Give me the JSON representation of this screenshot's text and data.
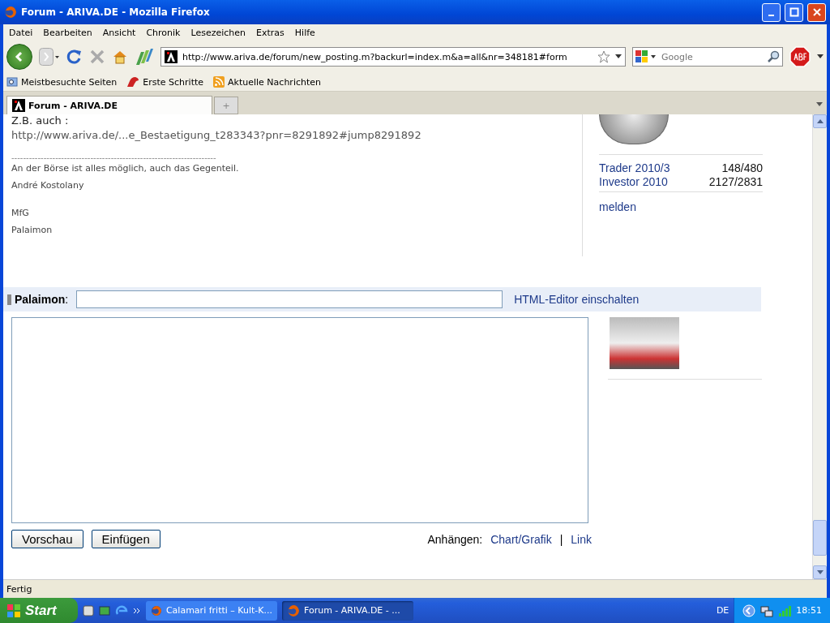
{
  "window": {
    "title": "Forum - ARIVA.DE - Mozilla Firefox"
  },
  "menu": [
    "Datei",
    "Bearbeiten",
    "Ansicht",
    "Chronik",
    "Lesezeichen",
    "Extras",
    "Hilfe"
  ],
  "navigation": {
    "url": "http://www.ariva.de/forum/new_posting.m?backurl=index.m&a=all&nr=348181#form",
    "search_placeholder": "Google"
  },
  "bookmarks": [
    "Meistbesuchte Seiten",
    "Erste Schritte",
    "Aktuelle Nachrichten"
  ],
  "tabs": [
    {
      "label": "Forum - ARIVA.DE",
      "selected": true
    }
  ],
  "new_tab": "+",
  "post": {
    "intro": "Z.B. auch :",
    "link": "http://www.ariva.de/...e_Bestaetigung_t283343?pnr=8291892#jump8291892",
    "separator": "----------------------------------------------------------------------",
    "signature": [
      [
        "An der Börse ist alles möglich, auch das Gegenteil.",
        "André Kostolany"
      ],
      [
        "MfG",
        "Palaimon"
      ]
    ]
  },
  "sidebar": {
    "stats": [
      {
        "label": "Trader 2010/3",
        "value": "148/480"
      },
      {
        "label": "Investor 2010",
        "value": "2127/2831"
      }
    ],
    "report_link": "melden"
  },
  "reply": {
    "username": "Palaimon",
    "username_colon": ":",
    "editor_toggle": "HTML-Editor einschalten",
    "buttons": [
      "Vorschau",
      "Einfügen"
    ],
    "attach_label": "Anhängen:",
    "attach_links": [
      "Chart/Grafik",
      "Link"
    ],
    "attach_separator": "|"
  },
  "status": "Fertig",
  "taskbar": {
    "start": "Start",
    "tasks": [
      {
        "label": "Calamari fritti – Kult-K...",
        "selected": false
      },
      {
        "label": "Forum - ARIVA.DE - ...",
        "selected": true
      }
    ],
    "language": "DE",
    "clock": "18:51"
  }
}
